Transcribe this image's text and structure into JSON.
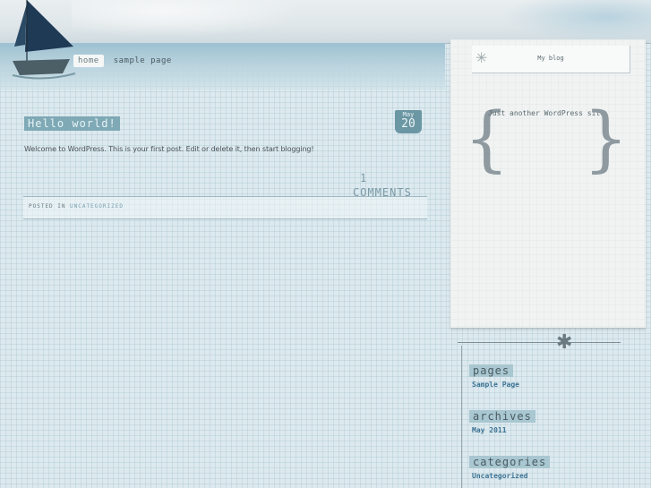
{
  "nav": {
    "items": [
      {
        "label": "home"
      },
      {
        "label": "sample page"
      }
    ]
  },
  "post": {
    "title": "Hello world!",
    "date": {
      "month": "May",
      "day": "20"
    },
    "body": "Welcome to WordPress. This is your first post. Edit or delete it, then start blogging!",
    "comments": {
      "count": "1",
      "label": "COMMENTS"
    },
    "meta": {
      "posted_in": "POSTED IN",
      "category": "UNCATEGORIZED"
    }
  },
  "sidebar": {
    "blog_title": "My blog",
    "description": "Just another WordPress site",
    "widgets": {
      "pages": {
        "title": "pages",
        "link": "Sample Page"
      },
      "archives": {
        "title": "archives",
        "link": "May 2011"
      },
      "categories": {
        "title": "categories",
        "link": "Uncategorized"
      }
    }
  },
  "colors": {
    "accent": "#7ea9b5",
    "link": "#3c7394",
    "paper": "#f0f3f2",
    "background": "#dce9ee"
  }
}
